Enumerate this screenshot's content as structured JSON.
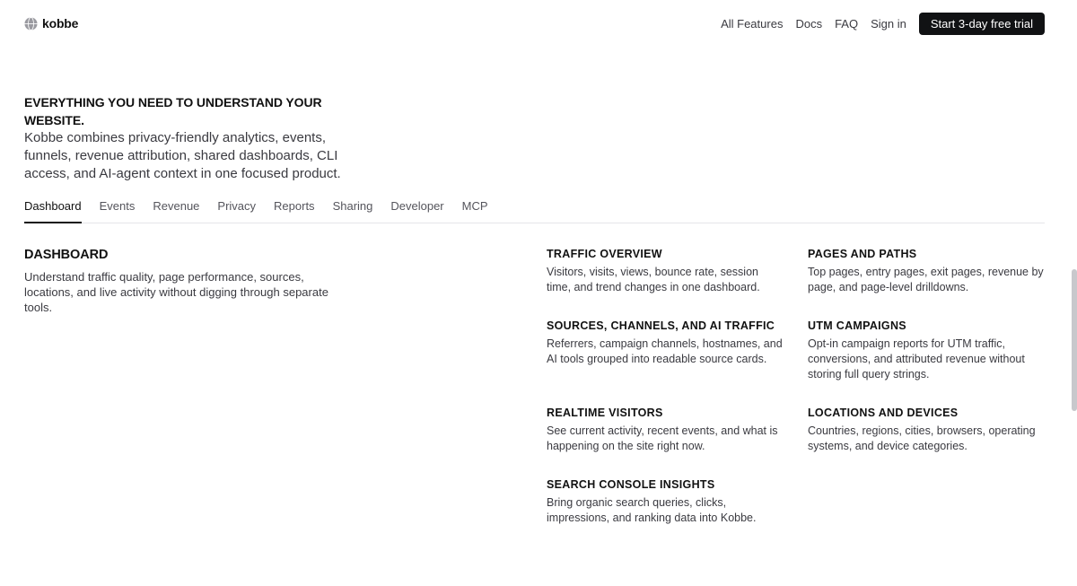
{
  "header": {
    "logo_text": "kobbe",
    "nav": [
      "All Features",
      "Docs",
      "FAQ",
      "Sign in"
    ],
    "cta": "Start 3-day free trial"
  },
  "hero": {
    "title": "Everything you need to understand your website.",
    "text": "Kobbe combines privacy-friendly analytics, events, funnels, revenue attribution, shared dashboards, CLI access, and AI-agent context in one focused product."
  },
  "tabs": [
    "Dashboard",
    "Events",
    "Revenue",
    "Privacy",
    "Reports",
    "Sharing",
    "Developer",
    "MCP"
  ],
  "active_tab": "Dashboard",
  "section": {
    "title": "Dashboard",
    "description": "Understand traffic quality, page performance, sources, locations, and live activity without digging through separate tools."
  },
  "features": [
    {
      "title": "Traffic overview",
      "text": "Visitors, visits, views, bounce rate, session time, and trend changes in one dashboard."
    },
    {
      "title": "Pages and paths",
      "text": "Top pages, entry pages, exit pages, revenue by page, and page-level drilldowns."
    },
    {
      "title": "Sources, channels, and AI traffic",
      "text": "Referrers, campaign channels, hostnames, and AI tools grouped into readable source cards."
    },
    {
      "title": "UTM campaigns",
      "text": "Opt-in campaign reports for UTM traffic, conversions, and attributed revenue without storing full query strings."
    },
    {
      "title": "Realtime visitors",
      "text": "See current activity, recent events, and what is happening on the site right now."
    },
    {
      "title": "Locations and devices",
      "text": "Countries, regions, cities, browsers, operating systems, and device categories."
    },
    {
      "title": "Search Console insights",
      "text": "Bring organic search queries, clicks, impressions, and ranking data into Kobbe."
    }
  ]
}
